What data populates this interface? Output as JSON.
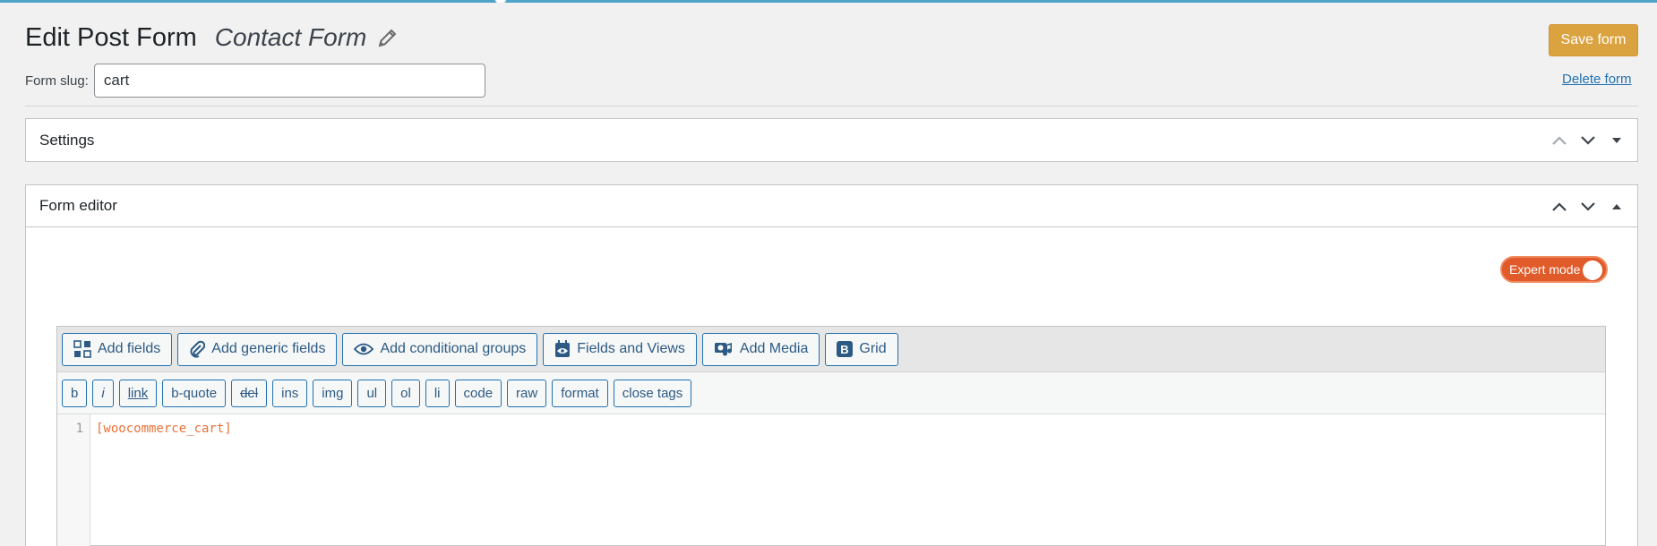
{
  "header": {
    "title": "Edit Post Form",
    "form_name": "Contact Form"
  },
  "slug": {
    "label": "Form slug:",
    "value": "cart"
  },
  "actions": {
    "save_label": "Save form",
    "delete_label": "Delete form"
  },
  "colors": {
    "accent": "#dba33f",
    "link": "#2271b1",
    "toggle": "#e15a29",
    "code": "#e8733a"
  },
  "settings_box": {
    "title": "Settings"
  },
  "editor_box": {
    "title": "Form editor"
  },
  "expert_mode": {
    "label": "Expert mode",
    "on": true
  },
  "toolbar": {
    "buttons": [
      {
        "label": "Add fields",
        "icon": "grid-dots-icon"
      },
      {
        "label": "Add generic fields",
        "icon": "paperclip-icon"
      },
      {
        "label": "Add conditional groups",
        "icon": "eye-icon"
      },
      {
        "label": "Fields and Views",
        "icon": "calendar-eye-icon"
      },
      {
        "label": "Add Media",
        "icon": "media-icon"
      },
      {
        "label": "Grid",
        "icon": "bootstrap-icon"
      }
    ]
  },
  "quicktags": [
    "b",
    "i",
    "link",
    "b-quote",
    "del",
    "ins",
    "img",
    "ul",
    "ol",
    "li",
    "code",
    "raw",
    "format",
    "close tags"
  ],
  "editor": {
    "line_number": "1",
    "content": "[woocommerce_cart]"
  }
}
